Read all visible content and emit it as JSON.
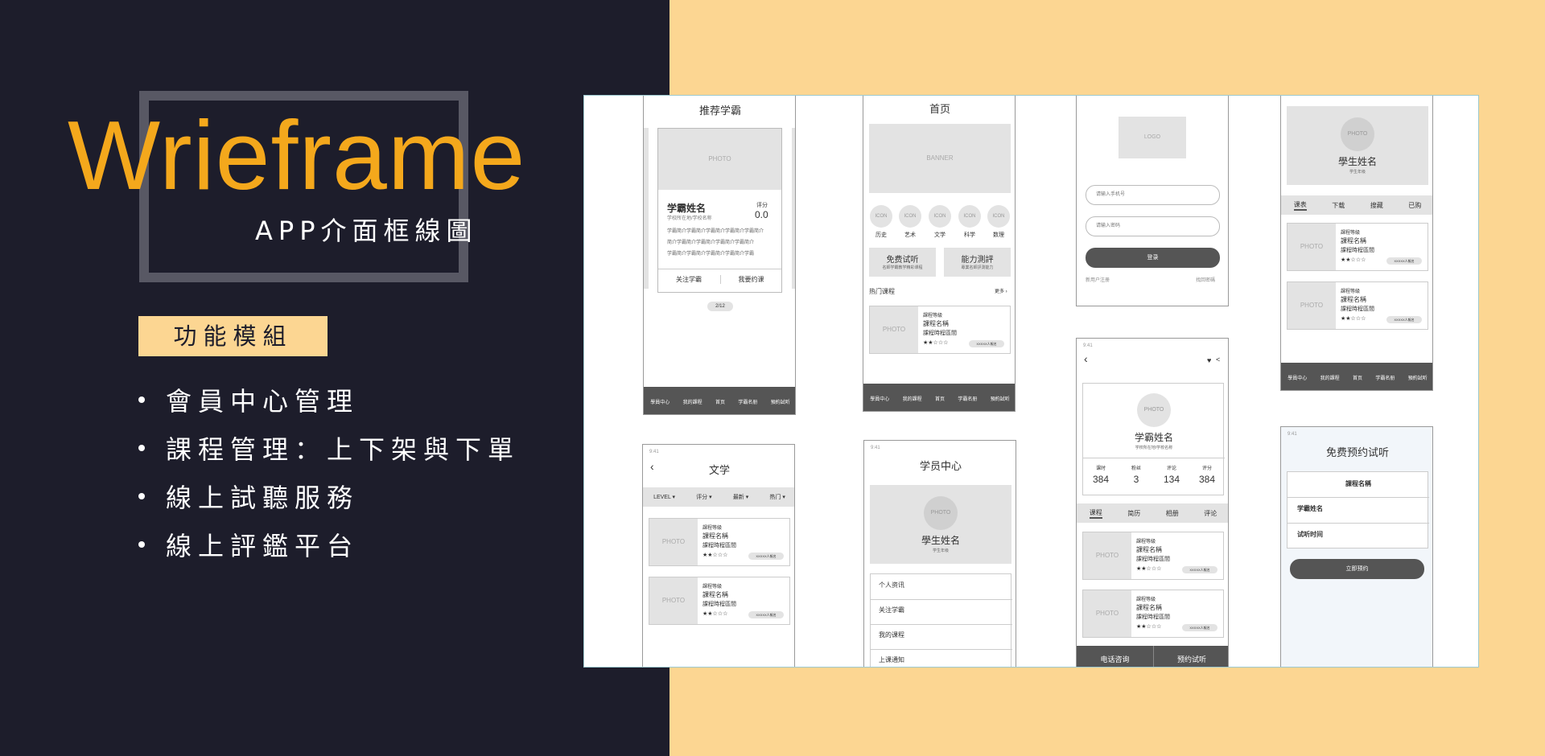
{
  "colors": {
    "accent": "#f4a81c",
    "left_bg": "#1d1d2b",
    "right_bg": "#fcd692",
    "frame": "#585864"
  },
  "hero": {
    "title": "Wrieframe",
    "subtitle": "APP介面框線圖"
  },
  "section": {
    "tag": "功能模組",
    "features": [
      "會員中心管理",
      "課程管理：上下架與下單",
      "線上試聽服務",
      "線上評鑑平台"
    ]
  },
  "common": {
    "photo": "PHOTO",
    "icon": "ICON",
    "time": "9:41",
    "course_level": "課程等級",
    "course_name": "課程名稱",
    "course_duration": "課程時程區間",
    "stars": "★★☆☆☆",
    "reserve_count": "XXXXX人報名"
  },
  "tabbar": [
    "學員中心",
    "我的課程",
    "首页",
    "学霸名册",
    "預約試听"
  ],
  "screen_recommend": {
    "title": "推荐学霸",
    "name": "学霸姓名",
    "school": "学校所在地/学校名称",
    "score_label": "评分",
    "score": "0.0",
    "intro": [
      "学霸简介学霸简介学霸简介学霸简介学霸简介",
      "简介学霸简介学霸简介学霸简介学霸简介",
      "学霸简介学霸简介学霸简介学霸简介学霸"
    ],
    "follow": "关注学霸",
    "book": "我要约课",
    "pager": "2/12"
  },
  "screen_home": {
    "title": "首页",
    "banner": "BANNER",
    "categories": [
      "历史",
      "艺术",
      "文学",
      "科学",
      "数理"
    ],
    "free_trial": "免费试听",
    "free_trial_sub": "名師学霸教学精彩课程",
    "ability": "能力測評",
    "ability_sub": "專業名師評測能力",
    "hot": "热门课程",
    "more": "更多 ›"
  },
  "screen_login": {
    "logo": "LOGO",
    "phone_placeholder": "请输入手机号",
    "pwd_placeholder": "请输入密码",
    "login": "登录",
    "register": "新用户注册",
    "forgot": "找回密碼"
  },
  "screen_student": {
    "name": "學生姓名",
    "grade": "学生年级",
    "tabs": [
      "课表",
      "下载",
      "搜藏",
      "已购"
    ]
  },
  "screen_literature": {
    "title": "文学",
    "filters": [
      "LEVEL ▾",
      "评分 ▾",
      "最新 ▾",
      "热门 ▾"
    ]
  },
  "screen_center": {
    "title": "学员中心",
    "name": "學生姓名",
    "grade": "学生年级",
    "menu": [
      "个人资讯",
      "关注学霸",
      "我的课程",
      "上课通知"
    ]
  },
  "screen_profile": {
    "name": "学霸姓名",
    "school": "学校所在地/学校名称",
    "stats": [
      {
        "label": "课时",
        "value": "384"
      },
      {
        "label": "粉丝",
        "value": "3"
      },
      {
        "label": "评论",
        "value": "134"
      },
      {
        "label": "评分",
        "value": "384"
      }
    ],
    "tabs": [
      "课程",
      "简历",
      "相册",
      "评论"
    ],
    "call": "电话咨询",
    "book": "预约试听"
  },
  "screen_trial": {
    "title": "免费预约试听",
    "course": "課程名稱",
    "xueba": "学霸姓名",
    "time": "试听时间",
    "submit": "立即预约"
  }
}
